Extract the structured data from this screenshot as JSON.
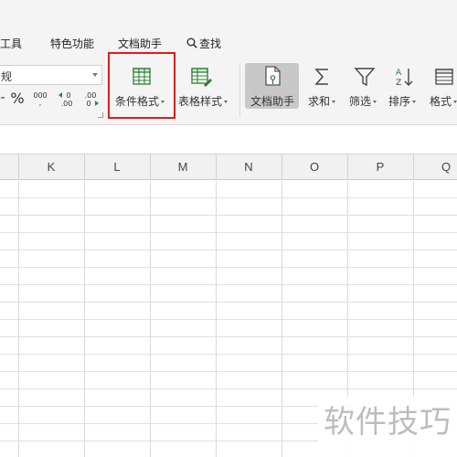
{
  "menu": {
    "items": [
      {
        "label": "工具"
      },
      {
        "label": "特色功能"
      },
      {
        "label": "文档助手"
      },
      {
        "label": "查找"
      }
    ]
  },
  "ribbon": {
    "number_format": {
      "value": "规",
      "buttons": [
        {
          "label": "-",
          "icon": "currency-icon"
        },
        {
          "label": "%",
          "icon": "percent-icon"
        },
        {
          "label": "000",
          "icon": "thousands-separator-icon"
        },
        {
          "label": "←0 .00",
          "icon": "increase-decimal-icon"
        },
        {
          "label": ".00 →0",
          "icon": "decrease-decimal-icon"
        }
      ]
    },
    "buttons": [
      {
        "label": "条件格式",
        "icon": "conditional-format-icon",
        "dropdown": true
      },
      {
        "label": "表格样式",
        "icon": "table-style-icon",
        "dropdown": true
      },
      {
        "label": "文档助手",
        "icon": "document-assistant-icon",
        "dropdown": false,
        "active": true
      },
      {
        "label": "求和",
        "icon": "sum-icon",
        "dropdown": true
      },
      {
        "label": "筛选",
        "icon": "filter-icon",
        "dropdown": true
      },
      {
        "label": "排序",
        "icon": "sort-icon",
        "dropdown": true
      },
      {
        "label": "格式",
        "icon": "format-icon",
        "dropdown": true
      }
    ],
    "highlight_color": "#e01b1b"
  },
  "sheet": {
    "columns": [
      "K",
      "L",
      "M",
      "N",
      "O",
      "P",
      "Q"
    ],
    "active_tab_color": "#c8c8c8"
  },
  "watermark": {
    "text": "软件技巧"
  }
}
